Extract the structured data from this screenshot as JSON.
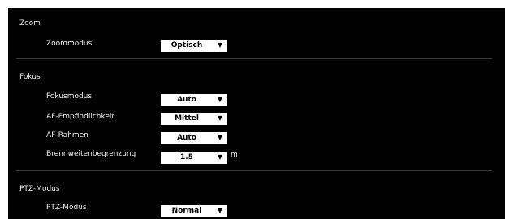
{
  "sections": {
    "zoom": {
      "title": "Zoom",
      "rows": [
        {
          "label": "Zoommodus",
          "value": "Optisch"
        }
      ]
    },
    "fokus": {
      "title": "Fokus",
      "rows": [
        {
          "label": "Fokusmodus",
          "value": "Auto"
        },
        {
          "label": "AF-Empfindlichkeit",
          "value": "Mittel"
        },
        {
          "label": "AF-Rahmen",
          "value": "Auto"
        },
        {
          "label": "Brennweitenbegrenzung",
          "value": "1.5",
          "unit": "m"
        }
      ]
    },
    "ptz": {
      "title": "PTZ-Modus",
      "rows": [
        {
          "label": "PTZ-Modus",
          "value": "Normal"
        }
      ]
    }
  },
  "icons": {
    "dropdown": "triangle-down-icon"
  },
  "colors": {
    "panel_bg": "#000000",
    "select_bg": "#ffffff",
    "text": "#ffffff",
    "separator": "#3a3a3a"
  }
}
